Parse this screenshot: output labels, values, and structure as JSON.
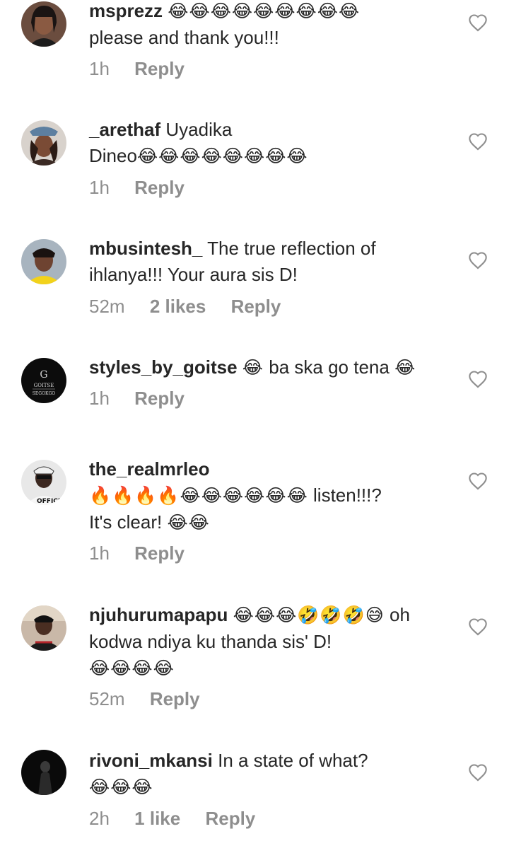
{
  "comments": [
    {
      "username": "msprezz",
      "text_before": "",
      "emoji": "😂😂😂😂😂😂😂😂😂",
      "text_line2": "please and thank you!!!",
      "time": "1h",
      "likes": "",
      "reply": "Reply"
    },
    {
      "username": "_arethaf",
      "text": "Uyadika",
      "text_line2": "Dineo",
      "emoji": "😂😂😂😂😂😂😂😂",
      "time": "1h",
      "likes": "",
      "reply": "Reply"
    },
    {
      "username": "mbusintesh_",
      "text": "The true reflection of",
      "text_line2": "ihlanya!!! Your aura sis D!",
      "time": "52m",
      "likes": "2 likes",
      "reply": "Reply"
    },
    {
      "username": "styles_by_goitse",
      "emoji1": "😂",
      "text": "ba ska go tena",
      "emoji2": "😂",
      "time": "1h",
      "likes": "",
      "reply": "Reply",
      "avatar_text1": "GOITSE",
      "avatar_text2": "SEGOKGO"
    },
    {
      "username": "the_realmrleo",
      "emoji_line": "🔥🔥🔥🔥😂😂😂😂😂😂",
      "text": "listen!!!?",
      "text_line3": "It's clear!",
      "emoji_end": "😂😂",
      "time": "1h",
      "likes": "",
      "reply": "Reply",
      "avatar_text": "OFFICE"
    },
    {
      "username": "njuhurumapapu",
      "emoji": "😂😂😂🤣🤣🤣😅",
      "text": "oh",
      "text_line2": "kodwa ndiya ku thanda sis' D!",
      "emoji_line3": "😂😂😂😂",
      "time": "52m",
      "likes": "",
      "reply": "Reply"
    },
    {
      "username": "rivoni_mkansi",
      "text": "In a state of what?",
      "emoji_line2": "😂😂😂",
      "time": "2h",
      "likes": "1 like",
      "reply": "Reply"
    }
  ],
  "icons": {
    "heart": "heart-outline-icon"
  },
  "colors": {
    "text": "#262626",
    "meta": "#8e8e8e",
    "heart_stroke": "#8e8e8e"
  }
}
